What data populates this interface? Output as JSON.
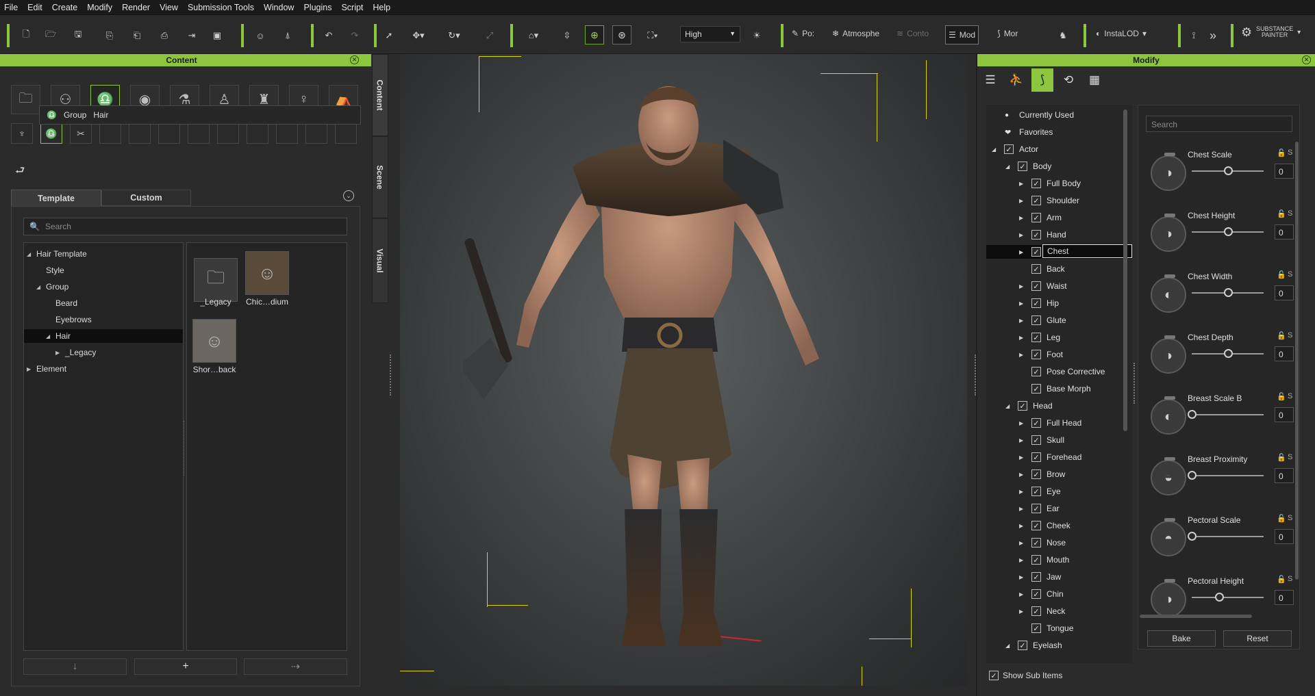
{
  "menu": [
    "File",
    "Edit",
    "Create",
    "Modify",
    "Render",
    "View",
    "Submission Tools",
    "Window",
    "Plugins",
    "Script",
    "Help"
  ],
  "toolbar": {
    "quality": "High",
    "pose_label": "Po:",
    "atmosphere_label": "Atmosphe",
    "contour_label": "Conto",
    "modify_label": "Mod",
    "morph_label": "Mor",
    "instalod_label": "InstaLOD",
    "substance_label": "SUBSTANCE PAINTER",
    "accent_color": "#8cc63f"
  },
  "content_panel": {
    "title": "Content",
    "breadcrumb": [
      "Group",
      "Hair"
    ],
    "tabs": [
      "Template",
      "Custom"
    ],
    "search_placeholder": "Search",
    "tree": [
      {
        "label": "Hair Template",
        "level": 0,
        "arrow": "down"
      },
      {
        "label": "Style",
        "level": 1,
        "arrow": ""
      },
      {
        "label": "Group",
        "level": 1,
        "arrow": "down"
      },
      {
        "label": "Beard",
        "level": 2,
        "arrow": ""
      },
      {
        "label": "Eyebrows",
        "level": 2,
        "arrow": ""
      },
      {
        "label": "Hair",
        "level": 2,
        "arrow": "down",
        "selected": true
      },
      {
        "label": "_Legacy",
        "level": 3,
        "arrow": "right"
      },
      {
        "label": "Element",
        "level": 0,
        "arrow": "right"
      }
    ],
    "thumbnails": [
      "_Legacy",
      "Chic…dium",
      "Shor…back"
    ],
    "side_tabs": [
      "Content",
      "Scene",
      "Visual"
    ]
  },
  "modify_panel": {
    "title": "Modify",
    "tree": [
      {
        "label": "Currently Used",
        "indent": 0,
        "type": "dot"
      },
      {
        "label": "Favorites",
        "indent": 0,
        "type": "heart"
      },
      {
        "label": "Actor",
        "indent": 0,
        "arrow": "down",
        "checked": true
      },
      {
        "label": "Body",
        "indent": 1,
        "arrow": "down",
        "checked": true
      },
      {
        "label": "Full Body",
        "indent": 2,
        "arrow": "right",
        "checked": true
      },
      {
        "label": "Shoulder",
        "indent": 2,
        "arrow": "right",
        "checked": true
      },
      {
        "label": "Arm",
        "indent": 2,
        "arrow": "right",
        "checked": true
      },
      {
        "label": "Hand",
        "indent": 2,
        "arrow": "right",
        "checked": true
      },
      {
        "label": "Chest",
        "indent": 2,
        "arrow": "right",
        "checked": true,
        "selected": true
      },
      {
        "label": "Back",
        "indent": 2,
        "arrow": "",
        "checked": true
      },
      {
        "label": "Waist",
        "indent": 2,
        "arrow": "right",
        "checked": true
      },
      {
        "label": "Hip",
        "indent": 2,
        "arrow": "right",
        "checked": true
      },
      {
        "label": "Glute",
        "indent": 2,
        "arrow": "right",
        "checked": true
      },
      {
        "label": "Leg",
        "indent": 2,
        "arrow": "right",
        "checked": true
      },
      {
        "label": "Foot",
        "indent": 2,
        "arrow": "right",
        "checked": true
      },
      {
        "label": "Pose Corrective",
        "indent": 2,
        "arrow": "",
        "checked": true
      },
      {
        "label": "Base Morph",
        "indent": 2,
        "arrow": "",
        "checked": true
      },
      {
        "label": "Head",
        "indent": 1,
        "arrow": "down",
        "checked": true
      },
      {
        "label": "Full Head",
        "indent": 2,
        "arrow": "right",
        "checked": true
      },
      {
        "label": "Skull",
        "indent": 2,
        "arrow": "right",
        "checked": true
      },
      {
        "label": "Forehead",
        "indent": 2,
        "arrow": "right",
        "checked": true
      },
      {
        "label": "Brow",
        "indent": 2,
        "arrow": "right",
        "checked": true
      },
      {
        "label": "Eye",
        "indent": 2,
        "arrow": "right",
        "checked": true
      },
      {
        "label": "Ear",
        "indent": 2,
        "arrow": "right",
        "checked": true
      },
      {
        "label": "Cheek",
        "indent": 2,
        "arrow": "right",
        "checked": true
      },
      {
        "label": "Nose",
        "indent": 2,
        "arrow": "right",
        "checked": true
      },
      {
        "label": "Mouth",
        "indent": 2,
        "arrow": "right",
        "checked": true
      },
      {
        "label": "Jaw",
        "indent": 2,
        "arrow": "right",
        "checked": true
      },
      {
        "label": "Chin",
        "indent": 2,
        "arrow": "right",
        "checked": true
      },
      {
        "label": "Neck",
        "indent": 2,
        "arrow": "right",
        "checked": true
      },
      {
        "label": "Tongue",
        "indent": 2,
        "arrow": "",
        "checked": true
      },
      {
        "label": "Eyelash",
        "indent": 1,
        "arrow": "down",
        "checked": true
      }
    ],
    "search_placeholder": "Search",
    "sliders": [
      {
        "name": "Chest Scale",
        "value": "0",
        "level": 0.5
      },
      {
        "name": "Chest Height",
        "value": "0",
        "level": 0.5
      },
      {
        "name": "Chest Width",
        "value": "0",
        "level": 0.5
      },
      {
        "name": "Chest Depth",
        "value": "0",
        "level": 0.5
      },
      {
        "name": "Breast Scale B",
        "value": "0",
        "level": 0.0
      },
      {
        "name": "Breast Proximity",
        "value": "0",
        "level": 0.0
      },
      {
        "name": "Pectoral Scale",
        "value": "0",
        "level": 0.0
      },
      {
        "name": "Pectoral Height",
        "value": "0",
        "level": 0.38
      }
    ],
    "bake_label": "Bake",
    "reset_label": "Reset",
    "show_sub_items": "Show Sub Items"
  }
}
